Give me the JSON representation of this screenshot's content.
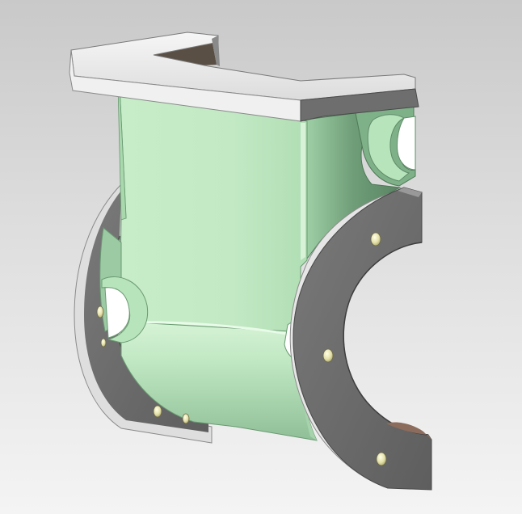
{
  "viewport": {
    "background_top": "#c9c9c9",
    "background_bottom": "#f4f4f4"
  },
  "model": {
    "part_color": "#bfe8c2",
    "part_shade": "#8fc49a",
    "flange_face_color": "#6e6e6e",
    "flange_edge_color": "#e0e0e0",
    "top_plate_color": "#ececec",
    "hole_marker_color": "#e6e2b0",
    "hole_marker_count": 7
  }
}
